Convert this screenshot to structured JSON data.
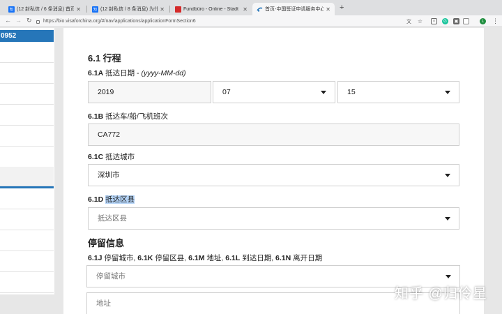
{
  "tabs": [
    {
      "title": "(12 封私信 / 6 条消息) 首页",
      "favicon": "知"
    },
    {
      "title": "(12 封私信 / 8 条消息) 为什",
      "favicon": "知"
    },
    {
      "title": "Fundbüro - Online - Stadt",
      "favicon": ""
    },
    {
      "title": "首页-中国签证申请服务中心",
      "favicon": ""
    }
  ],
  "url": "https://bio.visaforchina.org/#/nav/applications/applicationFormSection6",
  "profile_initial": "L",
  "left_panel": {
    "header": "0952"
  },
  "section_6_1": {
    "title": "6.1 行程",
    "arrival_date": {
      "label_num": "6.1A",
      "label": "抵达日期",
      "hint": "(yyyy-MM-dd)",
      "year": "2019",
      "month": "07",
      "day": "15"
    },
    "transport": {
      "label_num": "6.1B",
      "label": "抵达车/船/飞机班次",
      "value": "CA772"
    },
    "arrival_city": {
      "label_num": "6.1C",
      "label": "抵达城市",
      "value": "深圳市"
    },
    "arrival_district": {
      "label_num": "6.1D",
      "label": "抵达区县",
      "placeholder": "抵达区县"
    }
  },
  "stay_info": {
    "title": "停留信息",
    "desc": [
      {
        "num": "6.1J",
        "text": "停留城市,"
      },
      {
        "num": "6.1K",
        "text": "停留区县,"
      },
      {
        "num": "6.1M",
        "text": "地址,"
      },
      {
        "num": "6.1L",
        "text": "到达日期,"
      },
      {
        "num": "6.1N",
        "text": "离开日期"
      }
    ],
    "city_placeholder": "停留城市",
    "address_placeholder": "地址"
  },
  "watermark": "知乎 @归伶星",
  "colors": {
    "accent": "#2676b9",
    "selection": "#b4d4f8"
  }
}
